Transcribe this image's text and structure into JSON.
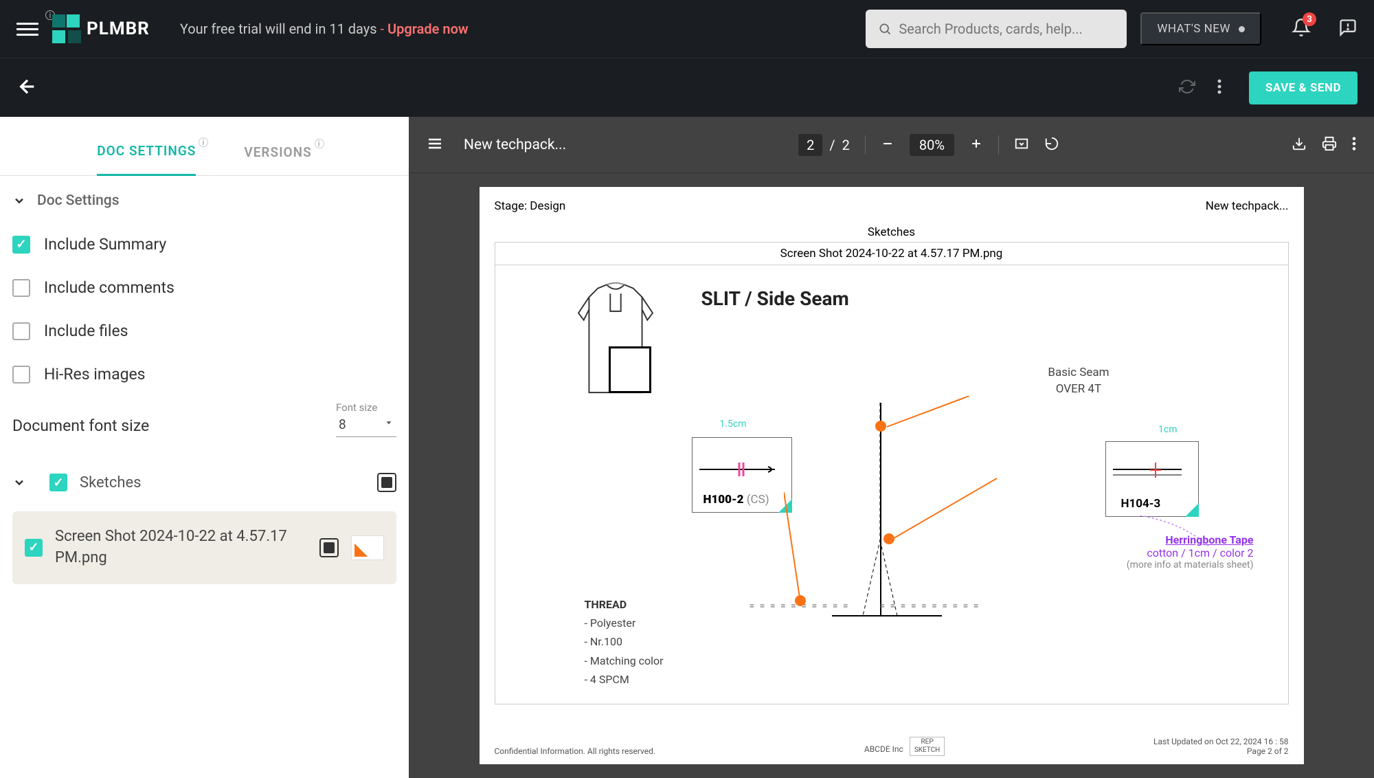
{
  "brand": "PLMBR",
  "trial": {
    "message": "Your free trial will end in 11 days ",
    "upgrade_prefix": "- ",
    "upgrade_text": "Upgrade now"
  },
  "search": {
    "placeholder": "Search Products, cards, help..."
  },
  "whats_new": "WHAT'S NEW",
  "notifications_count": "3",
  "save_send": "SAVE & SEND",
  "tabs": {
    "doc_settings": "DOC SETTINGS",
    "versions": "VERSIONS"
  },
  "section_title": "Doc Settings",
  "options": {
    "include_summary": "Include Summary",
    "include_comments": "Include comments",
    "include_files": "Include files",
    "hires_images": "Hi-Res images"
  },
  "font_size": {
    "label": "Document font size",
    "select_label": "Font size",
    "value": "8"
  },
  "sketches": {
    "header": "Sketches",
    "file_name": "Screen Shot 2024-10-22 at 4.57.17 PM.png"
  },
  "viewer": {
    "doc_title": "New techpack...",
    "page_current": "2",
    "page_sep": "/",
    "page_total": "2",
    "zoom": "80%"
  },
  "page": {
    "stage": "Stage: Design",
    "title_right": "New techpack...",
    "sketches_label": "Sketches",
    "caption": "Screen Shot 2024-10-22 at 4.57.17 PM.png",
    "detail_title": "SLIT / Side Seam",
    "seam_basic": "Basic Seam",
    "seam_over": "OVER 4T",
    "thread_title": "THREAD",
    "thread_1": "- Polyester",
    "thread_2": "- Nr.100",
    "thread_3": "- Matching color",
    "thread_4": "- 4 SPCM",
    "h100_dim": "1.5cm",
    "h100_label": "H100-2",
    "h100_suffix": " (CS)",
    "h104_dim": "1cm",
    "h104_label": "H104-3",
    "herr_1": "Herringbone Tape",
    "herr_2": "cotton / 1cm / color 2",
    "herr_3": "(more info at materials sheet)",
    "foot_left": "Confidential Information. All rights reserved.",
    "foot_mid": "ABCDE Inc",
    "foot_chip1": "REP",
    "foot_chip2": "SKETCH",
    "foot_upd": "Last Updated on Oct 22, 2024 16 : 58",
    "foot_page": "Page 2 of 2"
  }
}
